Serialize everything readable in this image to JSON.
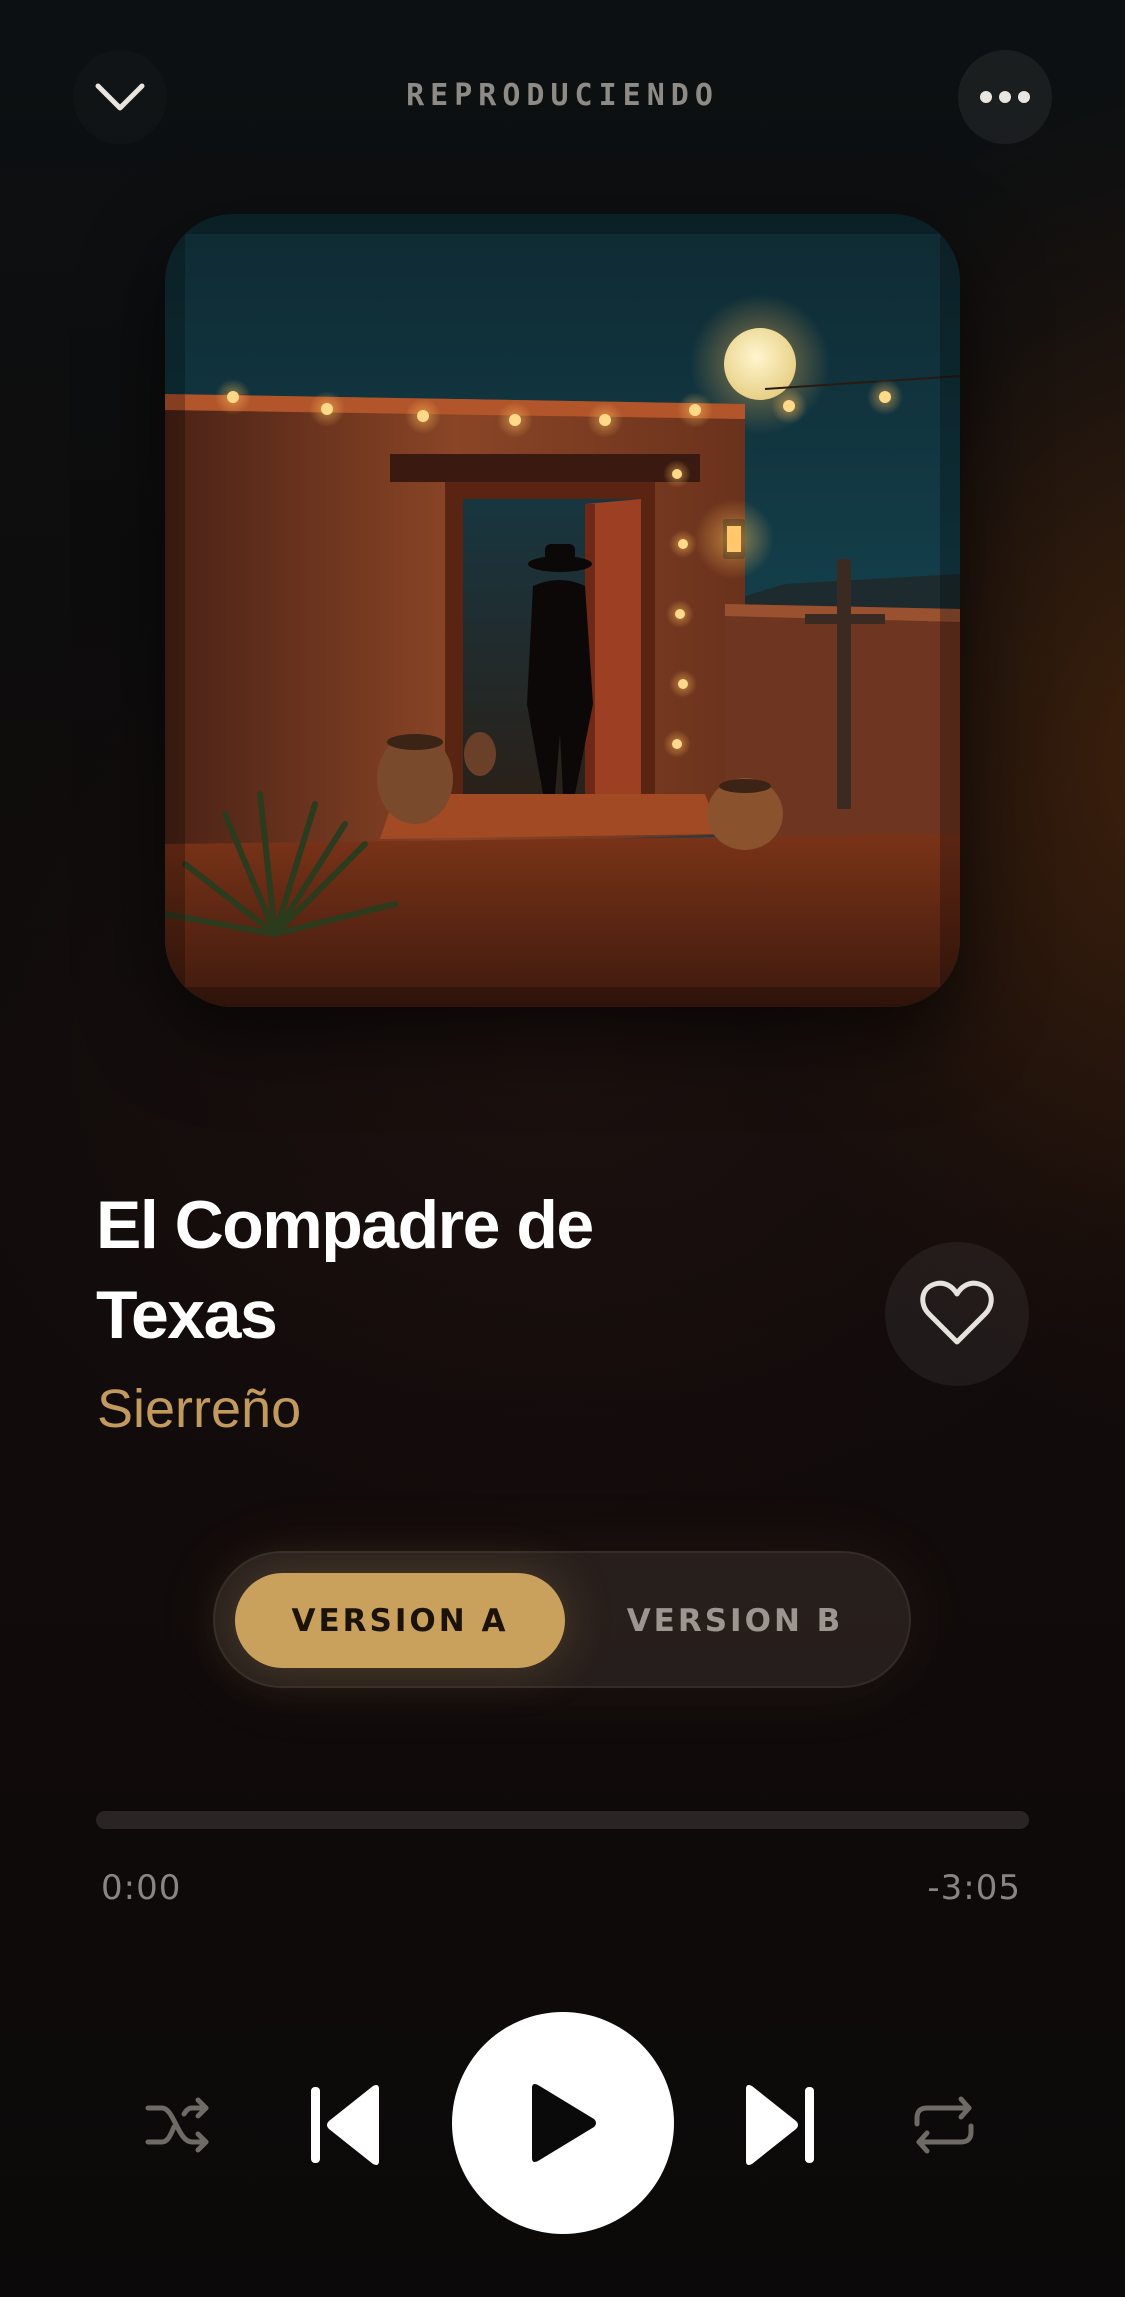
{
  "header": {
    "title": "REPRODUCIENDO",
    "collapse_icon": "chevron-down-icon",
    "more_icon": "more-horizontal-icon"
  },
  "artwork": {
    "description_icon": "album-artwork"
  },
  "track": {
    "title": "El Compadre de Texas",
    "artist": "Sierreño",
    "favorite_icon": "heart-icon"
  },
  "versions": {
    "options": [
      "VERSION A",
      "VERSION B"
    ],
    "selected": "VERSION A"
  },
  "progress": {
    "elapsed": "0:00",
    "remaining": "-3:05",
    "fraction": 0.0
  },
  "controls": {
    "shuffle_icon": "shuffle-icon",
    "previous_icon": "skip-previous-icon",
    "play_icon": "play-icon",
    "next_icon": "skip-next-icon",
    "repeat_icon": "repeat-icon"
  },
  "colors": {
    "accent": "#c9a15d",
    "artist": "#c39a5e",
    "background": "#0f0c0c"
  }
}
